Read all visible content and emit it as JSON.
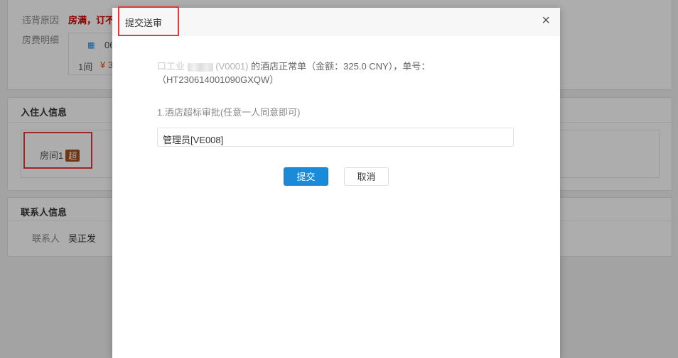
{
  "background": {
    "violation_label": "违背原因",
    "violation_value": "房满，订不",
    "room_fee_label": "房费明细",
    "fee_date_partial": "06",
    "fee_rooms": "1间",
    "fee_amount_partial": "¥ 3",
    "guest_section_title": "入住人信息",
    "room_name": "房间1",
    "over_badge": "超",
    "contact_section_title": "联系人信息",
    "contact_label": "联系人",
    "contact_name": "吴正发"
  },
  "modal": {
    "title": "提交送审",
    "close_symbol": "×",
    "message_prefix": "口工业",
    "message_id_partial": "(V0001)",
    "message_body": "的酒店正常单（金额：325.0 CNY），单号：（HT230614001090GXQW）",
    "approval_step": "1.酒店超标审批(任意一人同意即可)",
    "approver": "管理员[VE008]",
    "submit_label": "提交",
    "cancel_label": "取消"
  },
  "colors": {
    "primary": "#1a8ad9",
    "highlight": "#e53935",
    "warning_text": "#cc0000",
    "badge": "#a3521f"
  }
}
